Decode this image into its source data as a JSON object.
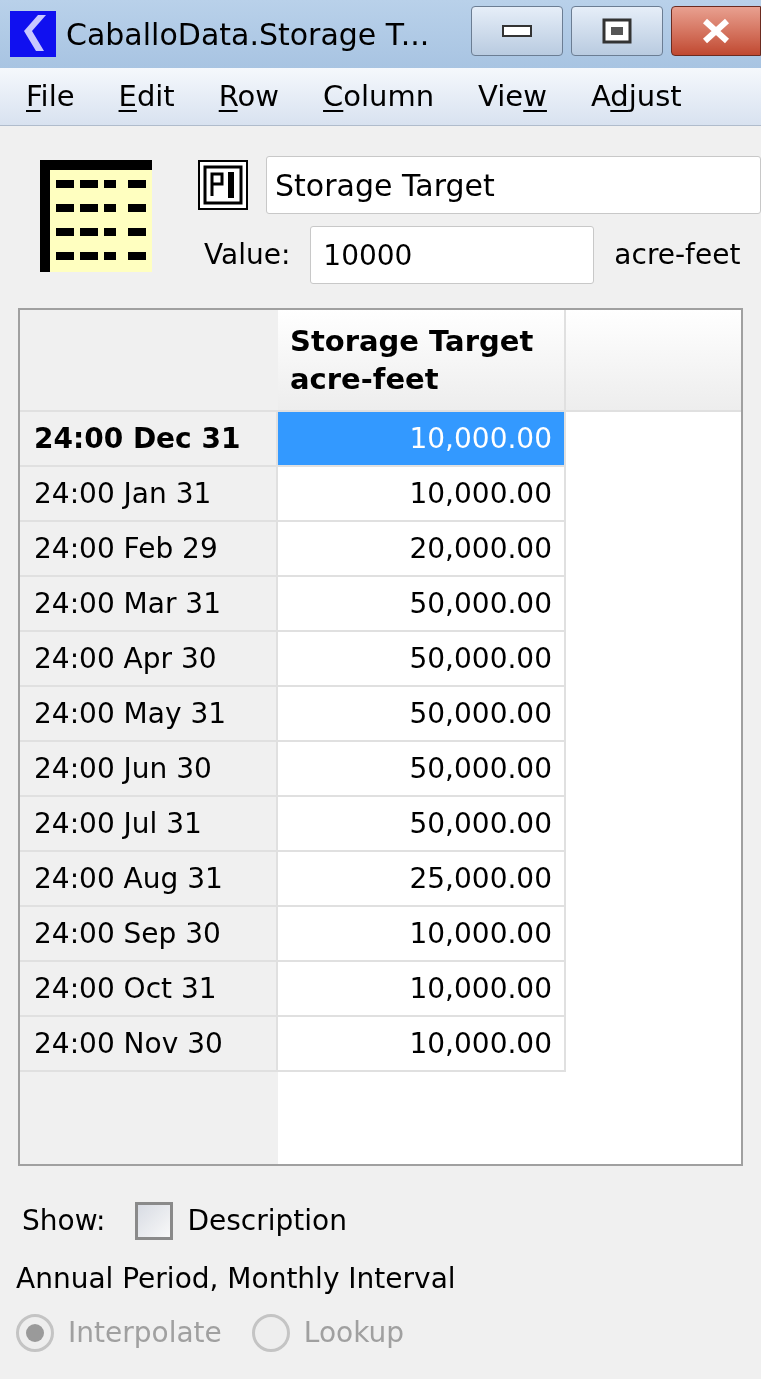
{
  "window": {
    "title": "CaballoData.Storage T..."
  },
  "menu": [
    {
      "key": "F",
      "after": "ile"
    },
    {
      "key": "E",
      "after": "dit"
    },
    {
      "key": "R",
      "after": "ow"
    },
    {
      "key": "C",
      "after": "olumn"
    },
    {
      "before": "Vie",
      "key": "w"
    },
    {
      "before": "A",
      "key": "d",
      "after": "just"
    }
  ],
  "name_field": {
    "value": "Storage Target"
  },
  "value_field": {
    "label": "Value:",
    "value": "10000",
    "units": "acre-feet"
  },
  "table": {
    "column": {
      "title": "Storage Target",
      "units": "acre-feet"
    },
    "rows": [
      {
        "date": "24:00 Dec 31",
        "value": "10,000.00",
        "selected": true
      },
      {
        "date": "24:00 Jan 31",
        "value": "10,000.00",
        "selected": false
      },
      {
        "date": "24:00 Feb 29",
        "value": "20,000.00",
        "selected": false
      },
      {
        "date": "24:00 Mar 31",
        "value": "50,000.00",
        "selected": false
      },
      {
        "date": "24:00 Apr 30",
        "value": "50,000.00",
        "selected": false
      },
      {
        "date": "24:00 May 31",
        "value": "50,000.00",
        "selected": false
      },
      {
        "date": "24:00 Jun 30",
        "value": "50,000.00",
        "selected": false
      },
      {
        "date": "24:00 Jul 31",
        "value": "50,000.00",
        "selected": false
      },
      {
        "date": "24:00 Aug 31",
        "value": "25,000.00",
        "selected": false
      },
      {
        "date": "24:00 Sep 30",
        "value": "10,000.00",
        "selected": false
      },
      {
        "date": "24:00 Oct 31",
        "value": "10,000.00",
        "selected": false
      },
      {
        "date": "24:00 Nov 30",
        "value": "10,000.00",
        "selected": false
      }
    ]
  },
  "show": {
    "label": "Show:",
    "checkbox": {
      "label": "Description",
      "checked": false
    }
  },
  "period": "Annual Period, Monthly Interval",
  "modes": [
    {
      "label": "Interpolate",
      "selected": true,
      "disabled": true
    },
    {
      "label": "Lookup",
      "selected": false,
      "disabled": true
    }
  ]
}
